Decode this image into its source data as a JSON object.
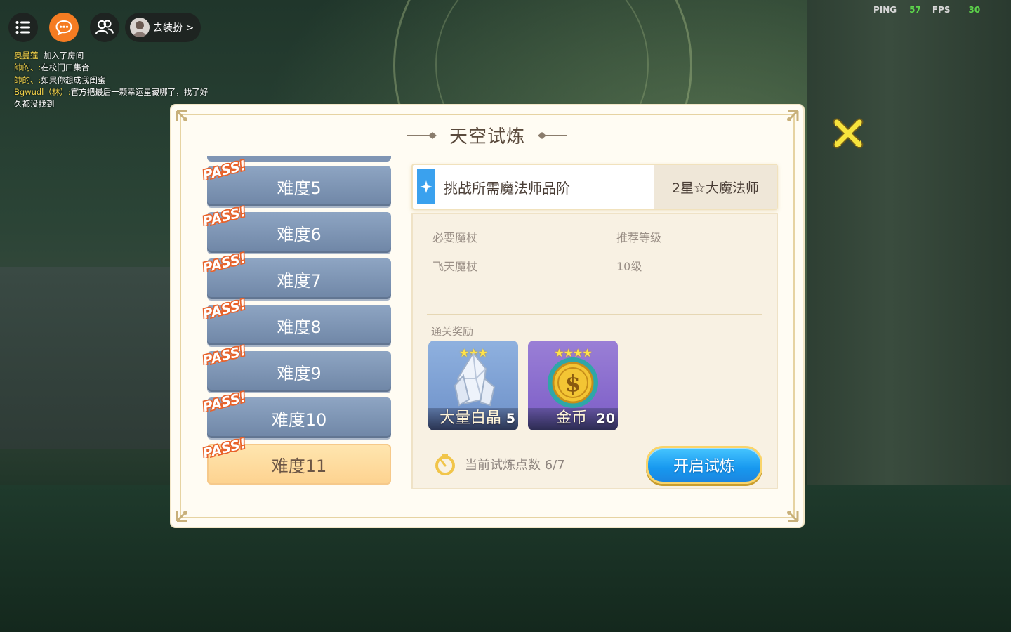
{
  "hud": {
    "menu_icon": "list-icon",
    "chat_icon": "chat-bubble-icon",
    "friends_icon": "friends-icon",
    "dress_label": "去装扮 >",
    "chat_messages": [
      {
        "name": "奥曼莲",
        "text": "加入了房间"
      },
      {
        "name": "帥的、:",
        "text": "在校门口集合"
      },
      {
        "name": "帥的、:",
        "text": "如果你想成我闺蜜"
      },
      {
        "name": "Bgwudl（林）:",
        "text": "官方把最后一颗幸运星藏哪了，找了好久都没找到"
      }
    ]
  },
  "stats": {
    "ping_label": "PING",
    "ping_value": "57",
    "fps_label": "FPS",
    "fps_value": "30"
  },
  "dialog": {
    "title": "天空试炼",
    "pass_label": "PASS!",
    "difficulties": [
      {
        "label": "难度5",
        "passed": true,
        "active": false
      },
      {
        "label": "难度6",
        "passed": true,
        "active": false
      },
      {
        "label": "难度7",
        "passed": true,
        "active": false
      },
      {
        "label": "难度8",
        "passed": true,
        "active": false
      },
      {
        "label": "难度9",
        "passed": true,
        "active": false
      },
      {
        "label": "难度10",
        "passed": true,
        "active": false
      },
      {
        "label": "难度11",
        "passed": true,
        "active": true
      }
    ],
    "requirement": {
      "label": "挑战所需魔法师品阶",
      "value": "2星☆大魔法师"
    },
    "info": {
      "wand_header": "必要魔杖",
      "level_header": "推荐等级",
      "wand_value": "飞天魔杖",
      "level_value": "10级"
    },
    "rewards_title": "通关奖励",
    "rewards": [
      {
        "name": "大量白晶",
        "count": "5",
        "stars": "★★★",
        "icon": "crystal-icon"
      },
      {
        "name": "金币",
        "count": "20",
        "stars": "★★★★",
        "icon": "gold-coin-icon"
      }
    ],
    "points_text": "当前试炼点数 6/7",
    "start_button": "开启试炼"
  },
  "colors": {
    "accent_orange": "#f57c22",
    "button_blue": "#1798ef",
    "item_blue": "#7f95b4",
    "item_active": "#fdd28f"
  }
}
